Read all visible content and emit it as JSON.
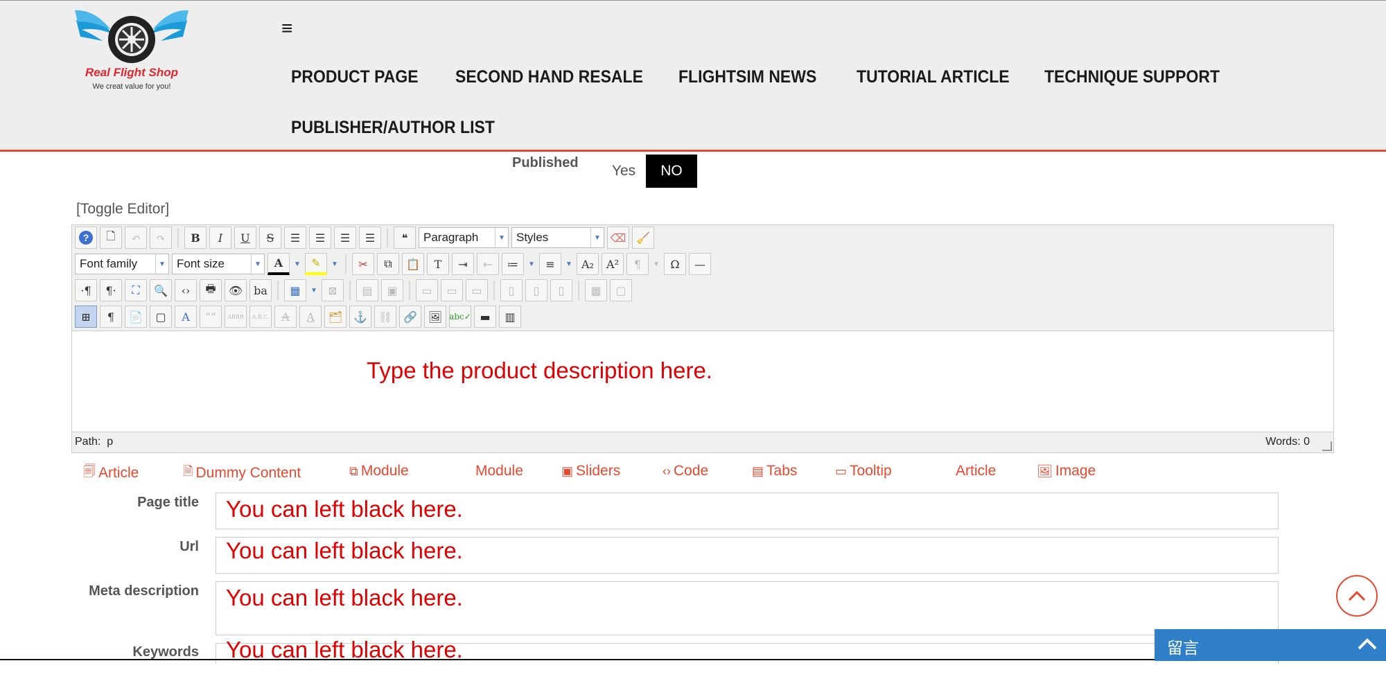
{
  "header": {
    "logo_name": "Real Flight Shop",
    "logo_tagline": "We creat value for you!",
    "nav": [
      "PRODUCT PAGE",
      "SECOND HAND RESALE",
      "FLIGHTSIM NEWS",
      "TUTORIAL ARTICLE",
      "TECHNIQUE SUPPORT",
      "PUBLISHER/AUTHOR LIST"
    ]
  },
  "published": {
    "label": "Published",
    "yes": "Yes",
    "no": "NO",
    "selected": "NO"
  },
  "toggle_editor": "[Toggle Editor]",
  "editor": {
    "format_select": "Paragraph",
    "styles_select": "Styles",
    "font_family_select": "Font family",
    "font_size_select": "Font size",
    "content": "Type the product description here.",
    "path_label": "Path:",
    "path_value": "p",
    "words_label": "Words: 0"
  },
  "extensions": [
    "Article",
    "Dummy Content",
    "Module",
    "Module",
    "Sliders",
    "Code",
    "Tabs",
    "Tooltip",
    "Article",
    "Image"
  ],
  "fields": [
    {
      "label": "Page title",
      "value": "You can left black here."
    },
    {
      "label": "Url",
      "value": "You can left black here."
    },
    {
      "label": "Meta description",
      "value": "You can left black here."
    },
    {
      "label": "Keywords",
      "value": "You can left black here."
    }
  ],
  "chat": {
    "label": "留言"
  },
  "colors": {
    "accent": "#e8472f",
    "chat": "#2f80c8",
    "annotation": "#e00000"
  }
}
